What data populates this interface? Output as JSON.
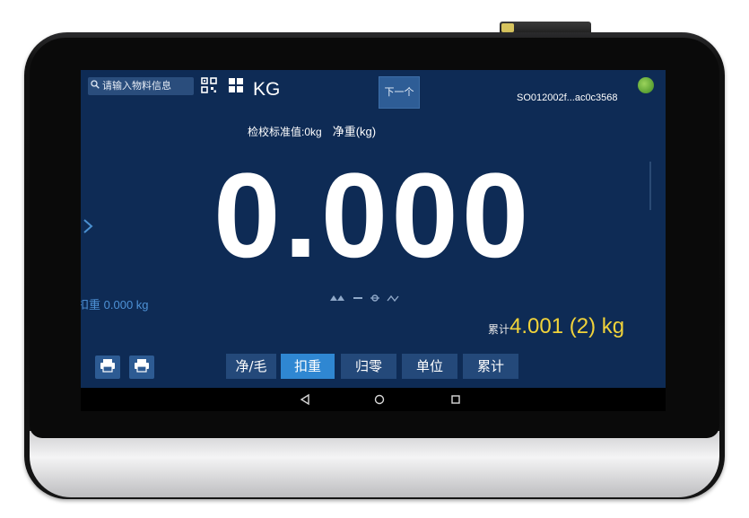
{
  "topbar": {
    "search_placeholder": "请输入物料信息",
    "unit": "KG",
    "next_button": "下一个",
    "serial": "SO012002f...ac0c3568"
  },
  "calibration": {
    "standard_label": "检校标准值:0kg",
    "net_label": "净重(kg)"
  },
  "display": {
    "weight": "0.000"
  },
  "tare": {
    "label": "扣重",
    "value": "0.000 kg"
  },
  "accumulate": {
    "label": "累计",
    "value": "4.001 (2) kg"
  },
  "function_buttons": [
    {
      "label": "净/毛"
    },
    {
      "label": "扣重"
    },
    {
      "label": "归零"
    },
    {
      "label": "单位"
    },
    {
      "label": "累计"
    }
  ],
  "colors": {
    "screen_bg": "#0e2b55",
    "accent_blue": "#2f87d2",
    "accum_yellow": "#f1d33a",
    "status_green": "#6fbf3a"
  },
  "icons": {
    "search": "magnifier-icon",
    "qr": "qr-code-icon",
    "grid": "grid-icon",
    "print1": "printer-icon",
    "print2": "printer-icon",
    "nav_back": "triangle-back-icon",
    "nav_home": "circle-home-icon",
    "nav_recent": "square-recent-icon"
  }
}
